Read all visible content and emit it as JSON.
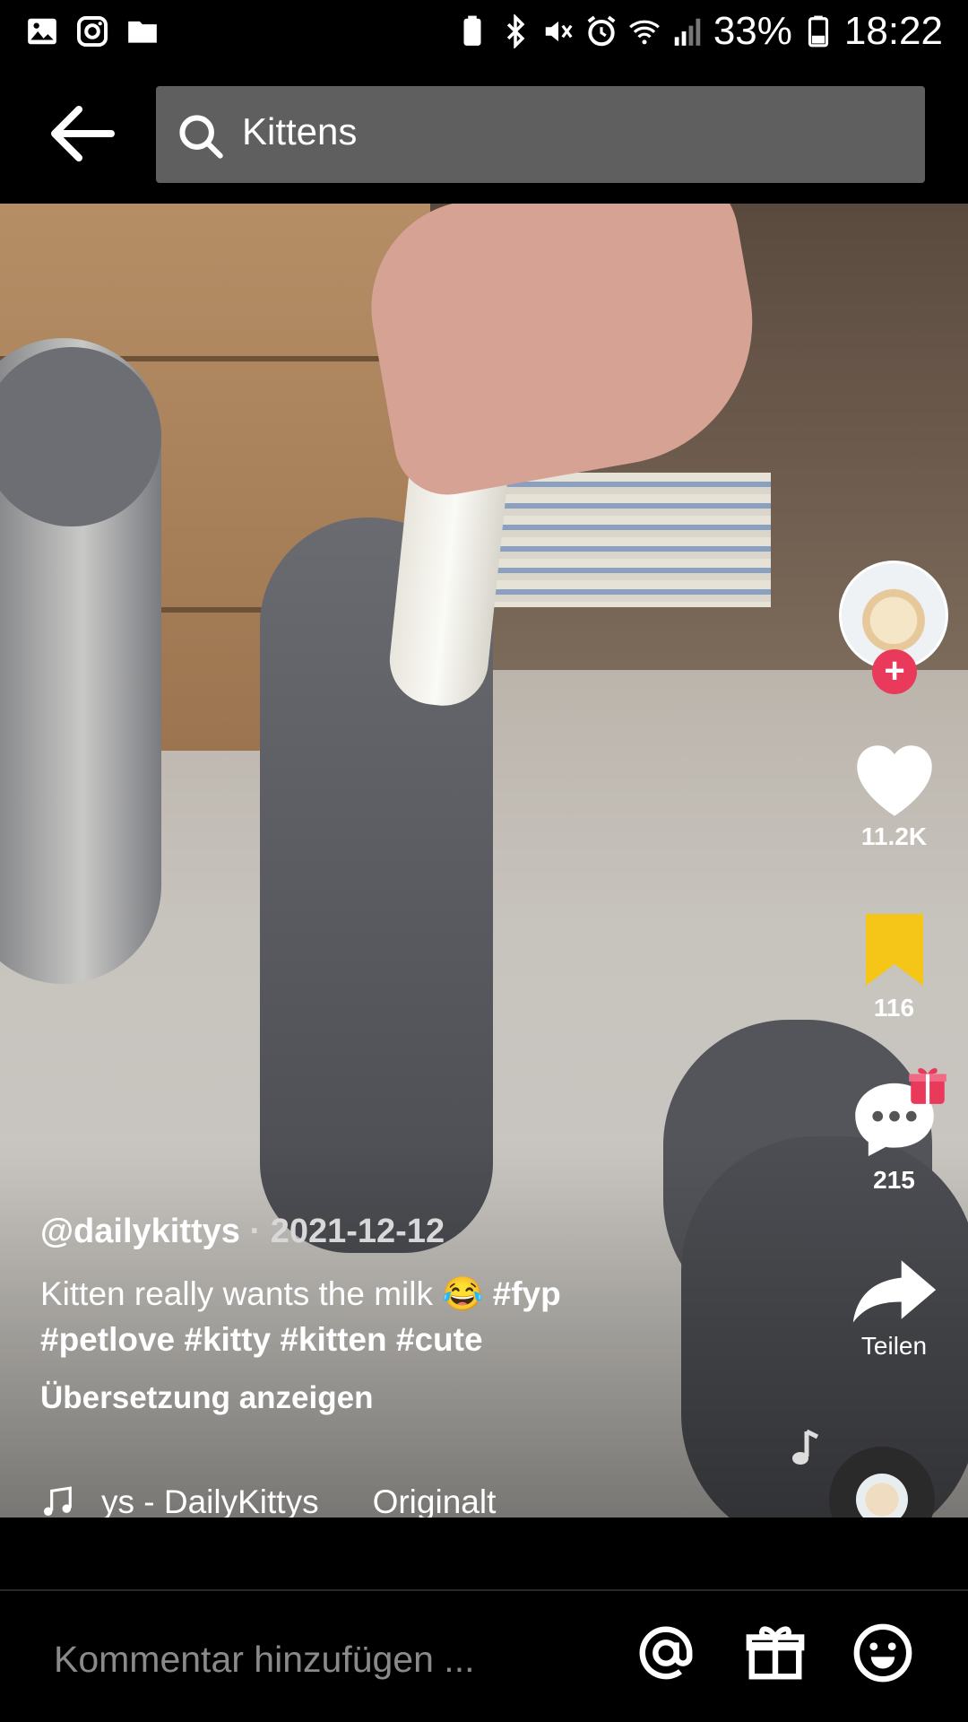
{
  "status_bar": {
    "battery": "33%",
    "time": "18:22"
  },
  "header": {
    "search_text": "Kittens"
  },
  "video": {
    "username": "@dailykittys",
    "separator": " · ",
    "date": "2021-12-12",
    "caption_text": "Kitten really wants the milk 😂 ",
    "hashtags": [
      "#fyp",
      "#petlove",
      "#kitty",
      "#kitten",
      "#cute"
    ],
    "translate_label": "Übersetzung anzeigen",
    "music_text": "ys - DailyKittys",
    "music_original": "Originalt"
  },
  "actions": {
    "likes": "11.2K",
    "saves": "116",
    "comments": "215",
    "share_label": "Teilen"
  },
  "comment_bar": {
    "placeholder": "Kommentar hinzufügen ..."
  },
  "colors": {
    "follow": "#ea3a5c",
    "bookmark": "#f5c518",
    "search_bg": "#5f5f5f"
  }
}
